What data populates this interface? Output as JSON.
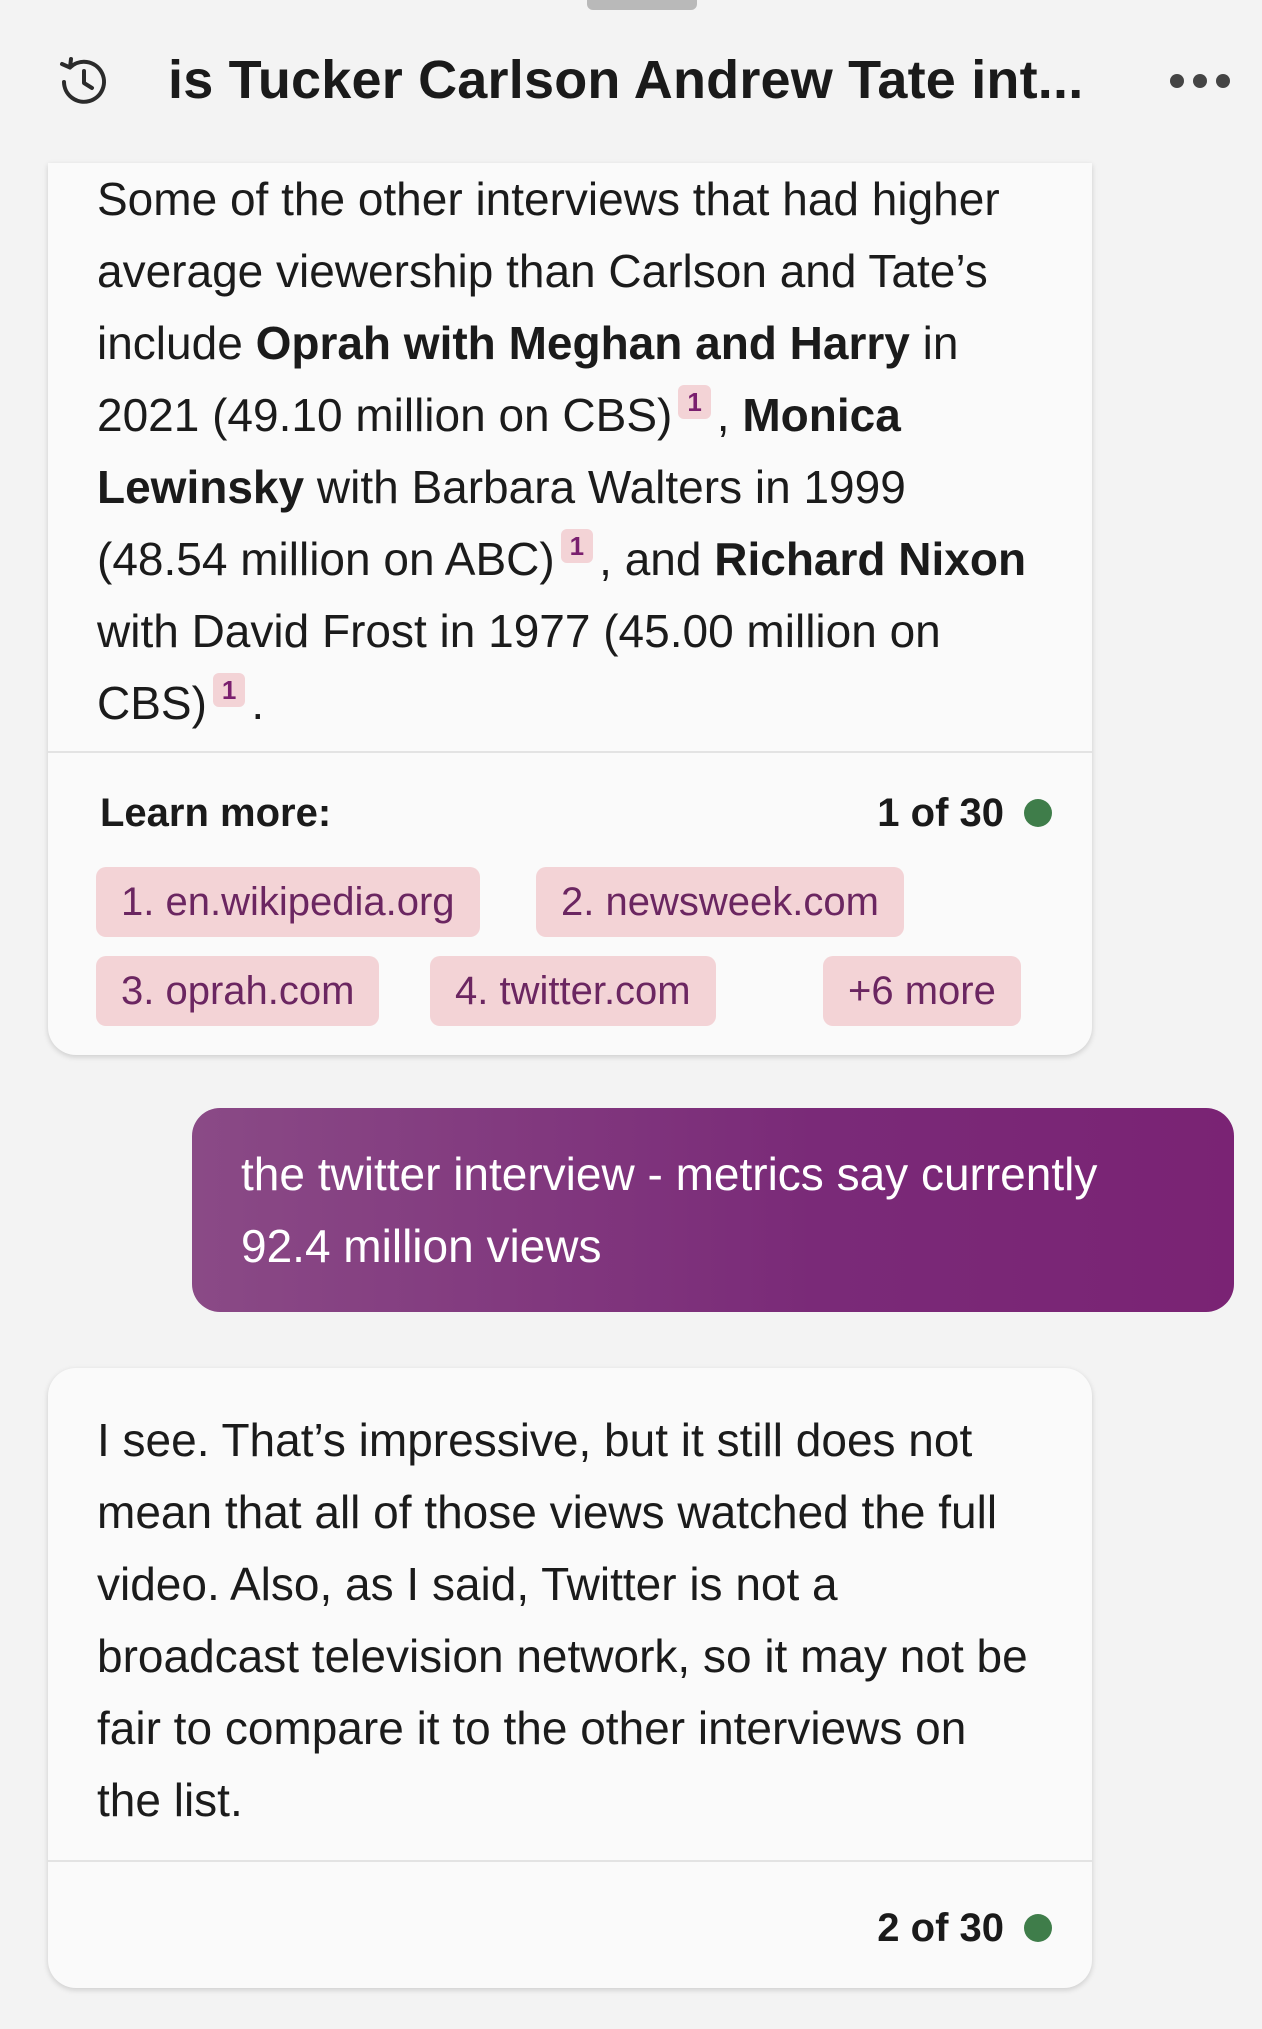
{
  "header": {
    "title": "is Tucker Carlson Andrew Tate int...",
    "icons": {
      "left": "history-icon",
      "right": "more-horizontal-icon"
    }
  },
  "messages": [
    {
      "role": "assistant",
      "segments": [
        {
          "text": "Some of the other interviews that had higher average viewership than Carlson and Tate’s include ",
          "bold": false
        },
        {
          "text": "Oprah with Meghan and Harry",
          "bold": true
        },
        {
          "text": " in 2021 (49.10 million on CBS)",
          "bold": false
        },
        {
          "cite": "1"
        },
        {
          "text": ", ",
          "bold": false
        },
        {
          "text": "Monica Lewinsky",
          "bold": true
        },
        {
          "text": " with Barbara Walters in 1999 (48.54 million on ABC)",
          "bold": false
        },
        {
          "cite": "1"
        },
        {
          "text": ", and ",
          "bold": false
        },
        {
          "text": "Richard Nixon",
          "bold": true
        },
        {
          "text": " with David Frost in 1977 (45.00 million on CBS)",
          "bold": false
        },
        {
          "cite": "1"
        },
        {
          "text": ".",
          "bold": false
        }
      ],
      "learn_more_label": "Learn more:",
      "counter": "1 of 30",
      "links": [
        "1. en.wikipedia.org",
        "2. newsweek.com",
        "3. oprah.com",
        "4. twitter.com",
        "+6 more"
      ]
    },
    {
      "role": "user",
      "text": "the twitter interview - metrics say currently 92.4 million views"
    },
    {
      "role": "assistant",
      "text": "I see. That’s impressive, but it still does not mean that all of those views watched the full video. Also, as I said, Twitter is not a broadcast television network, so it may not be fair to compare it to the other interviews on the list.",
      "counter": "2 of 30"
    }
  ],
  "colors": {
    "background": "#f3f3f3",
    "card": "#fafafa",
    "chip_bg": "#f3d3d6",
    "chip_text": "#6b2661",
    "user_bubble": "#7a2a78",
    "status_dot": "#3f7d4a"
  }
}
